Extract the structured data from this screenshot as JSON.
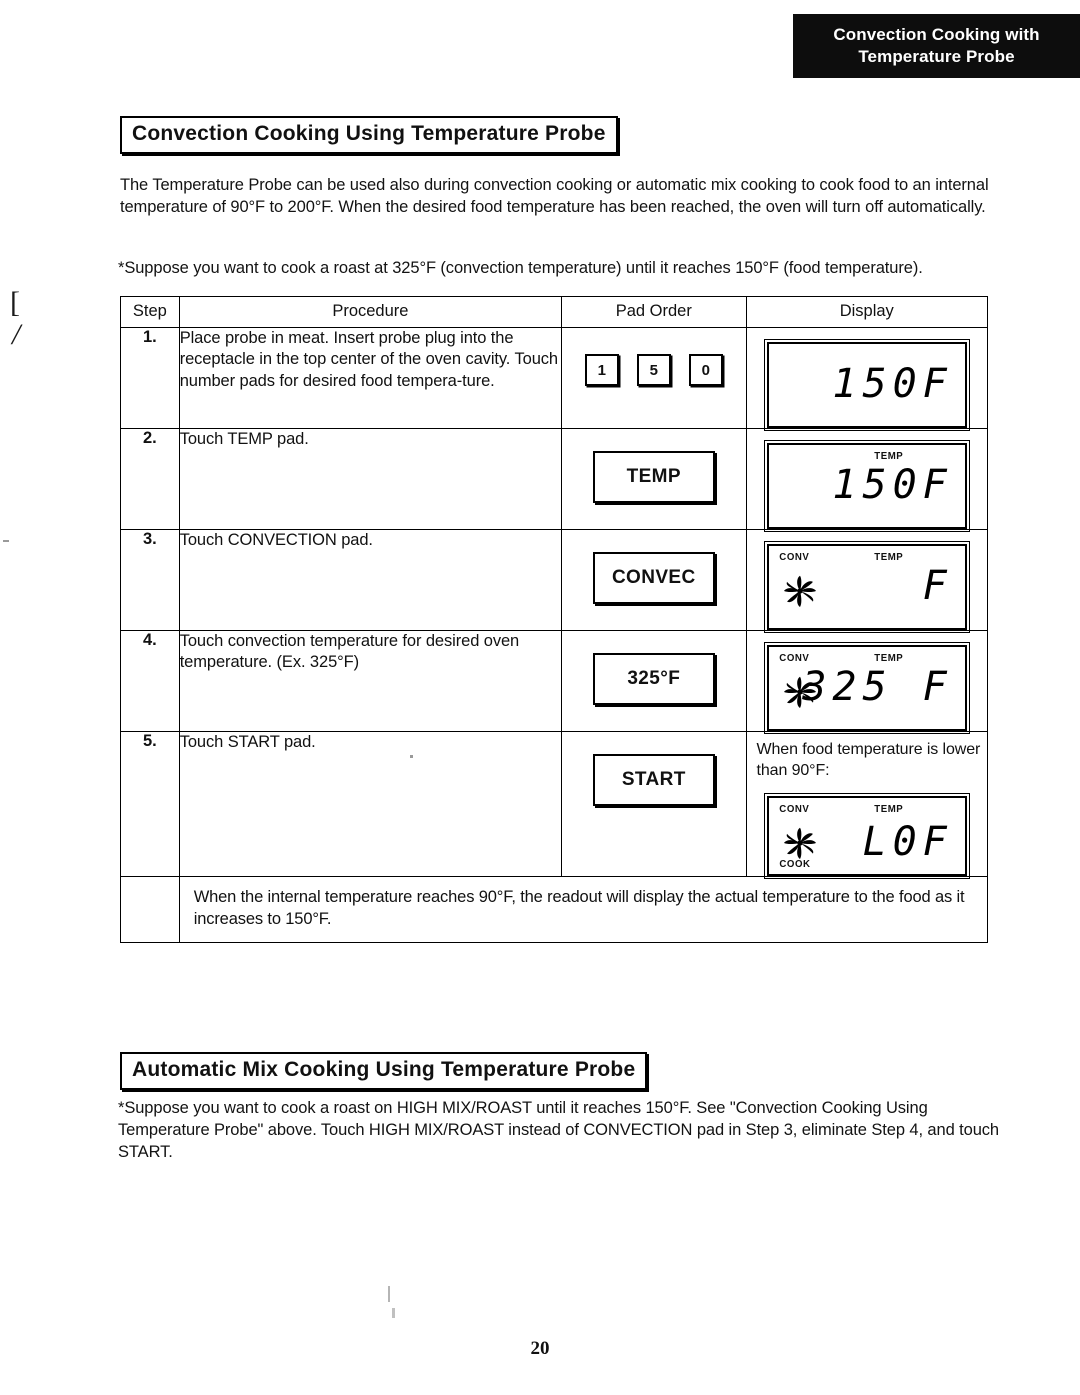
{
  "header_tab": {
    "line1": "Convection Cooking with",
    "line2": "Temperature Probe"
  },
  "sections": {
    "convection": {
      "heading": "Convection Cooking Using Temperature Probe",
      "intro": "The Temperature Probe can be used also during convection cooking or automatic mix cooking to cook food to an internal temperature of 90°F to 200°F. When the desired food temperature has been reached, the oven will turn off automatically.",
      "suppose": "*Suppose you want to cook a roast at 325°F (convection temperature) until it reaches 150°F (food temperature)."
    },
    "automix": {
      "heading": "Automatic Mix Cooking Using Temperature Probe",
      "body": "*Suppose you want to cook a roast on HIGH MIX/ROAST until it reaches 150°F. See \"Convection Cooking Using Temperature Probe\" above.  Touch HIGH MIX/ROAST instead of CONVECTION pad in Step 3, eliminate Step 4, and touch START."
    }
  },
  "table": {
    "headers": {
      "step": "Step",
      "procedure": "Procedure",
      "pad_order": "Pad Order",
      "display": "Display"
    },
    "rows": [
      {
        "step": "1.",
        "procedure": "Place probe in meat.  Insert probe plug into the receptacle in the top center of the oven cavity.\nTouch number pads for desired food tempera-ture.",
        "pads": [
          "1",
          "5",
          "0"
        ],
        "pad_type": "numbers",
        "display": {
          "digits": "150F",
          "conv": "",
          "temp": "",
          "cook": "",
          "fan": false
        }
      },
      {
        "step": "2.",
        "procedure": "Touch TEMP pad.",
        "pads": [
          "TEMP"
        ],
        "pad_type": "big",
        "display": {
          "digits": "150F",
          "conv": "",
          "temp": "TEMP",
          "cook": "",
          "fan": false
        }
      },
      {
        "step": "3.",
        "procedure": "Touch CONVECTION pad.",
        "pads": [
          "CONVEC"
        ],
        "pad_type": "big",
        "display": {
          "digits": "F",
          "conv": "CONV",
          "temp": "TEMP",
          "cook": "",
          "fan": true
        }
      },
      {
        "step": "4.",
        "procedure": "Touch convection temperature for desired oven temperature. (Ex.  325°F)",
        "pads": [
          "325°F"
        ],
        "pad_type": "big",
        "display": {
          "digits": "325 F",
          "conv": "CONV",
          "temp": "TEMP",
          "cook": "",
          "fan": true
        }
      },
      {
        "step": "5.",
        "procedure": "Touch START pad.",
        "pads": [
          "START"
        ],
        "pad_type": "big",
        "display_caption": "When food temperature is lower than 90°F:",
        "display": {
          "digits": "L0F",
          "conv": "CONV",
          "temp": "TEMP",
          "cook": "COOK",
          "fan": true
        }
      }
    ],
    "note": "When the internal temperature reaches 90°F, the readout will display the actual temperature to the food as it increases to 150°F."
  },
  "page_number": "20",
  "margin_marks": {
    "mark1": "[",
    "mark2": "/"
  }
}
